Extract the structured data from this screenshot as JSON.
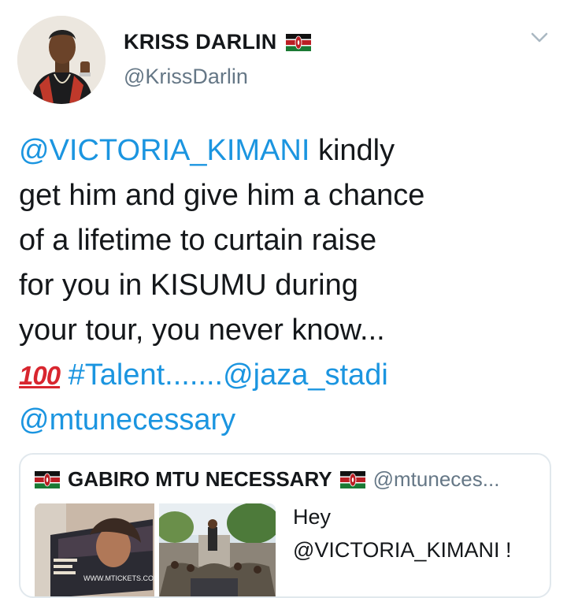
{
  "tweet": {
    "author": {
      "name": "KRISS DARLIN",
      "handle": "@KrissDarlin",
      "flag_icon": "kenya-flag-icon"
    },
    "menu_icon": "chevron-down-icon",
    "text_lines": [
      {
        "mention": "@VICTORIA_KIMANI",
        "rest": " kindly"
      },
      {
        "text": "get him and give him a chance"
      },
      {
        "text": "of a lifetime to curtain raise"
      },
      {
        "text": "for you in KISUMU during"
      },
      {
        "text": "your tour, you never know..."
      },
      {
        "emoji": "100",
        "hashtag": "#Talent",
        "dots": ".......",
        "mention": "@jaza_stadi"
      },
      {
        "mention": "@mtunecessary"
      }
    ]
  },
  "quoted": {
    "name": "GABIRO MTU NECESSARY",
    "handle": "@mtuneces...",
    "flag_icon": "kenya-flag-icon",
    "text_lines": [
      "Hey",
      "@VICTORIA_KIMANI !"
    ],
    "media": [
      {
        "kind": "poster",
        "caption": "WWW.MTICKETS.COM"
      },
      {
        "kind": "crowd-photo"
      }
    ]
  },
  "colors": {
    "link": "#1b95e0",
    "text": "#14171a",
    "muted": "#657786",
    "border": "#e1e8ed",
    "emoji_red": "#d8262f"
  }
}
